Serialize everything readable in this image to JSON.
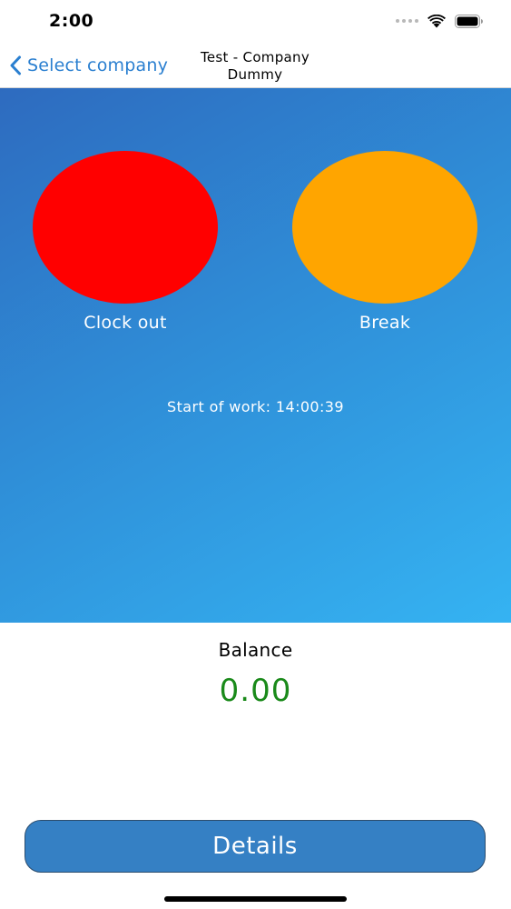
{
  "status_bar": {
    "time": "2:00",
    "icons": [
      "cellular-signal-icon",
      "wifi-icon",
      "battery-icon"
    ]
  },
  "nav": {
    "back_label": "Select company",
    "title_line1": "Test - Company",
    "title_line2": "Dummy",
    "accent_color": "#2a7fd0"
  },
  "actions": {
    "clock_out": {
      "label": "Clock out",
      "color": "#ff0000"
    },
    "break": {
      "label": "Break",
      "color": "#ffa500"
    }
  },
  "start_info": "Start of work: 14:00:39",
  "balance": {
    "label": "Balance",
    "value": "0.00",
    "value_color": "#1a8a1a"
  },
  "details_button": {
    "label": "Details",
    "color": "#3580c4"
  }
}
